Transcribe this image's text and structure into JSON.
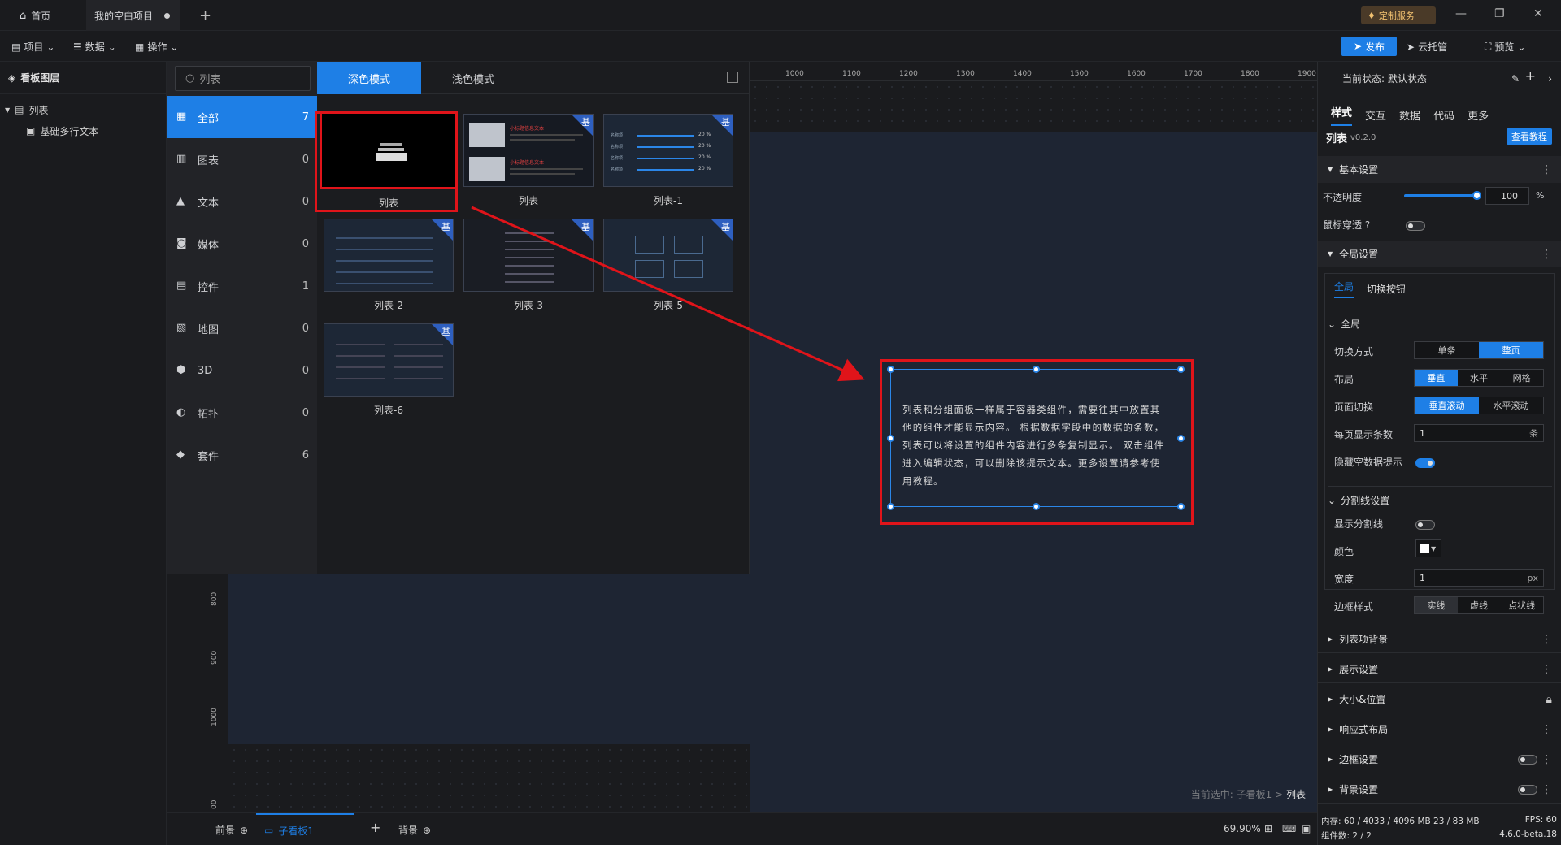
{
  "titlebar": {
    "home_label": "首页",
    "project_tab": "我的空白项目",
    "custom_service": "定制服务"
  },
  "toolbar": {
    "project": "项目",
    "data": "数据",
    "operate": "操作",
    "publish": "发布",
    "cloud": "云托管",
    "preview": "预览"
  },
  "layers": {
    "title": "看板图层",
    "items": [
      "列表",
      "基础多行文本"
    ]
  },
  "library": {
    "search_value": "列表",
    "tab_dark": "深色模式",
    "tab_light": "浅色模式",
    "categories": [
      {
        "label": "全部",
        "count": "7"
      },
      {
        "label": "图表",
        "count": "0"
      },
      {
        "label": "文本",
        "count": "0"
      },
      {
        "label": "媒体",
        "count": "0"
      },
      {
        "label": "控件",
        "count": "1"
      },
      {
        "label": "地图",
        "count": "0"
      },
      {
        "label": "3D",
        "count": "0"
      },
      {
        "label": "拓扑",
        "count": "0"
      },
      {
        "label": "套件",
        "count": "6"
      }
    ],
    "cards": [
      {
        "label": "列表",
        "badge": ""
      },
      {
        "label": "列表",
        "badge": "基"
      },
      {
        "label": "列表-1",
        "badge": "基"
      },
      {
        "label": "列表-2",
        "badge": "基"
      },
      {
        "label": "列表-3",
        "badge": "基"
      },
      {
        "label": "列表-5",
        "badge": "基"
      },
      {
        "label": "列表-6",
        "badge": "基"
      }
    ],
    "thumb_titles": [
      "小标题信息文本",
      "小标题信息文本"
    ],
    "thumb_rows": [
      "20 %",
      "20 %",
      "20 %",
      "20 %"
    ],
    "thumb_row_label": "名称项"
  },
  "canvas": {
    "ruler_top": [
      "1000",
      "1100",
      "1200",
      "1300",
      "1400",
      "1500",
      "1600",
      "1700",
      "1800",
      "1900"
    ],
    "ruler_left": [
      "800",
      "900",
      "1000",
      "00"
    ],
    "widget_text": "列表和分组面板一样属于容器类组件，需要往其中放置其他的组件才能显示内容。 根据数据字段中的数据的条数，列表可以将设置的组件内容进行多条复制显示。 双击组件进入编辑状态，可以删除该提示文本。更多设置请参考使用教程。",
    "selected_prefix": "当前选中: 子看板1 > ",
    "selected_name": "列表"
  },
  "bottombar": {
    "front": "前景",
    "subboard": "子看板1",
    "back": "背景",
    "zoom": "69.90%"
  },
  "rpanel": {
    "state_label": "当前状态: 默认状态",
    "tabs": [
      "样式",
      "交互",
      "数据",
      "代码",
      "更多"
    ],
    "component_name": "列表",
    "component_version": "v0.2.0",
    "tutorial_btn": "查看教程",
    "basic_title": "基本设置",
    "opacity_label": "不透明度",
    "opacity_value": "100",
    "opacity_unit": "%",
    "opacity_level": 1.0,
    "mouse_through": "鼠标穿透",
    "global_title": "全局设置",
    "global_tabs": [
      "全局",
      "切换按钮"
    ],
    "global_sub": "全局",
    "switch_mode_label": "切换方式",
    "switch_mode_opts": [
      "单条",
      "整页"
    ],
    "layout_label": "布局",
    "layout_opts": [
      "垂直",
      "水平",
      "网格"
    ],
    "page_switch_label": "页面切换",
    "page_switch_opts": [
      "垂直滚动",
      "水平滚动"
    ],
    "per_page_label": "每页显示条数",
    "per_page_value": "1",
    "per_page_unit": "条",
    "hide_empty_label": "隐藏空数据提示",
    "divider_title": "分割线设置",
    "show_divider": "显示分割线",
    "color_label": "颜色",
    "width_label": "宽度",
    "width_value": "1",
    "width_unit": "px",
    "border_style_label": "边框样式",
    "border_style_opts": [
      "实线",
      "虚线",
      "点状线"
    ],
    "sections": [
      "列表项背景",
      "展示设置",
      "大小&位置",
      "响应式布局",
      "边框设置",
      "背景设置"
    ],
    "status_mem": "内存:  60 / 4033 / 4096 MB  23 / 83 MB",
    "status_fps": "FPS:  60",
    "status_count": "组件数: 2 / 2",
    "status_version": "4.6.0-beta.18"
  },
  "colors": {
    "accent": "#1e7fe6",
    "highlight_red": "#e0141a"
  }
}
